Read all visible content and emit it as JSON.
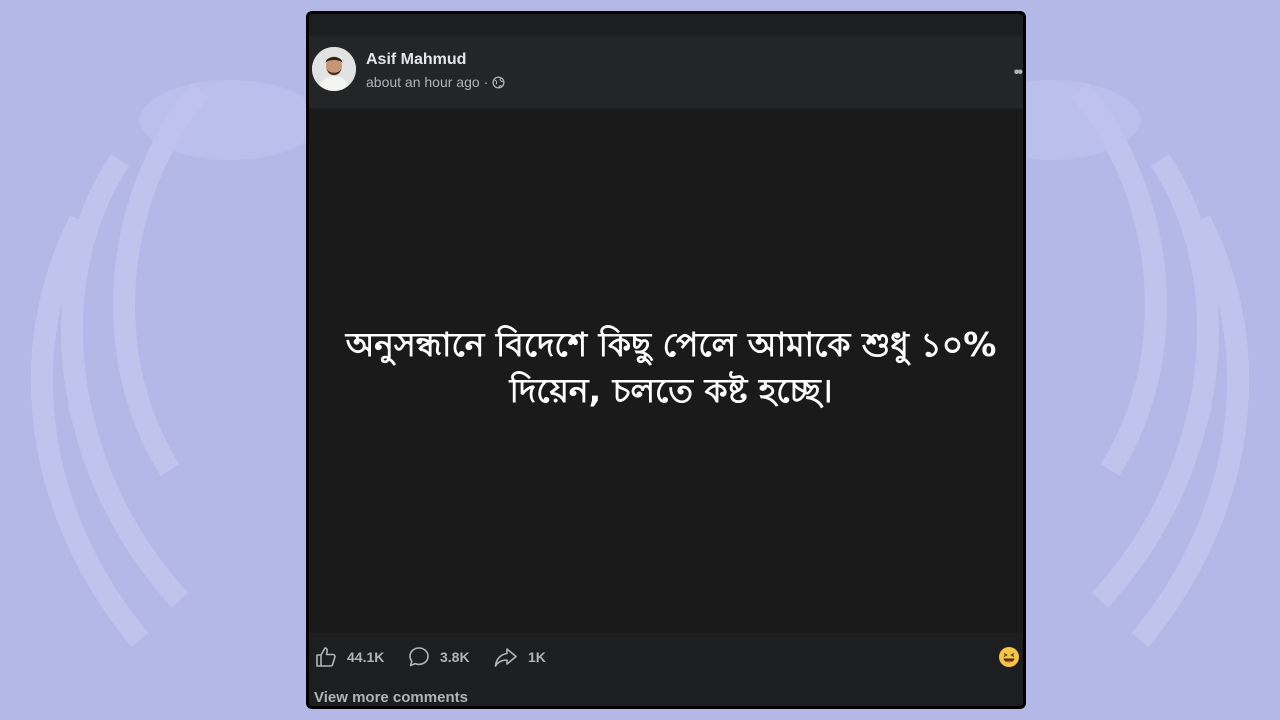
{
  "post": {
    "author": "Asif Mahmud",
    "timestamp": "about an hour ago",
    "separator": "·",
    "audience_icon": "globe-icon",
    "more_icon": "more-options-icon",
    "more_glyph": "••",
    "status_text": "অনুসন্ধানে বিদেশে কিছু পেলে আমাকে শুধু ১০% দিয়েন, চলতে কষ্ট হচ্ছে।",
    "reactions": {
      "like_count": "44.1K",
      "comment_count": "3.8K",
      "share_count": "1K",
      "reaction_emoji": "laughing-emoji-icon"
    },
    "view_more_comments": "View more comments"
  },
  "colors": {
    "page_background": "#b4b9e6",
    "post_frame": "#000000",
    "post_background": "#1d1e20",
    "status_background": "#1a1a1a",
    "primary_text": "#e4e6eb",
    "secondary_text": "#b0b3b8",
    "status_text": "#ffffff"
  }
}
